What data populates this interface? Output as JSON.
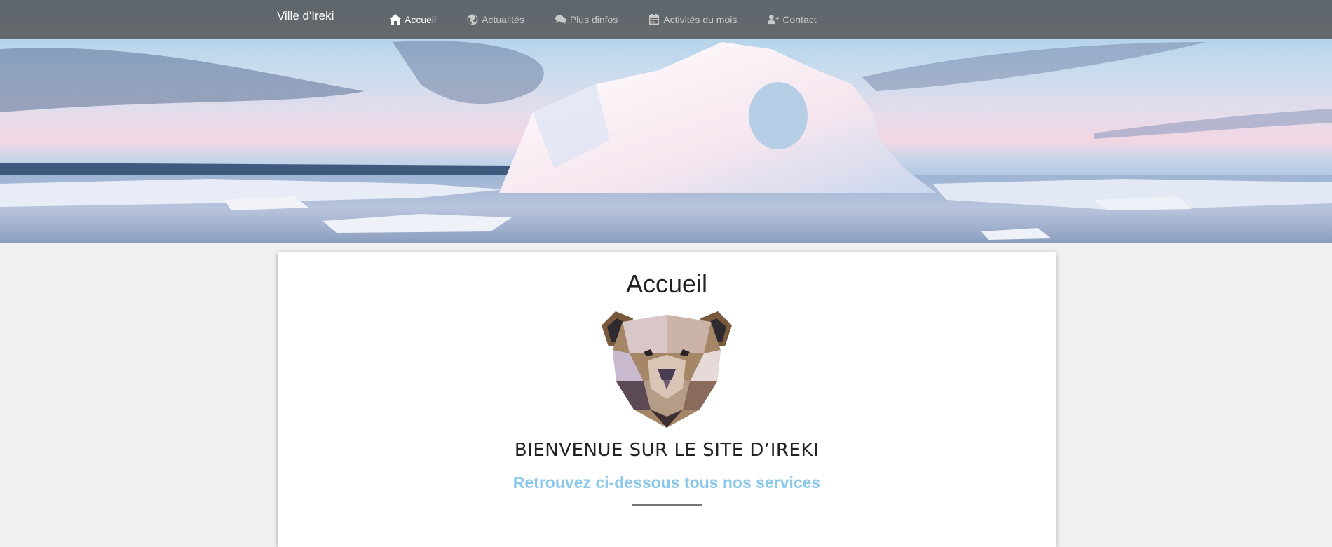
{
  "site": {
    "brand": "Ville d'Ireki"
  },
  "nav": {
    "items": [
      {
        "label": "Accueil",
        "icon": "home-icon",
        "active": true
      },
      {
        "label": "Actualités",
        "icon": "globe-icon",
        "active": false
      },
      {
        "label": "Plus dinfos",
        "icon": "comments-icon",
        "active": false
      },
      {
        "label": "Activités du mois",
        "icon": "calendar-icon",
        "active": false
      },
      {
        "label": "Contact",
        "icon": "user-plus-icon",
        "active": false
      }
    ]
  },
  "hero": {
    "image": "iceberg-banner"
  },
  "main": {
    "title": "Accueil",
    "logo": "polygonal-bear-logo",
    "welcome": "BIENVENUE SUR LE SITE D’IREKI",
    "subtitle": "Retrouvez ci-dessous tous nos services"
  },
  "colors": {
    "navbar": "#505050",
    "accent": "#8cc8ea",
    "page_background": "#f0f0f0"
  }
}
